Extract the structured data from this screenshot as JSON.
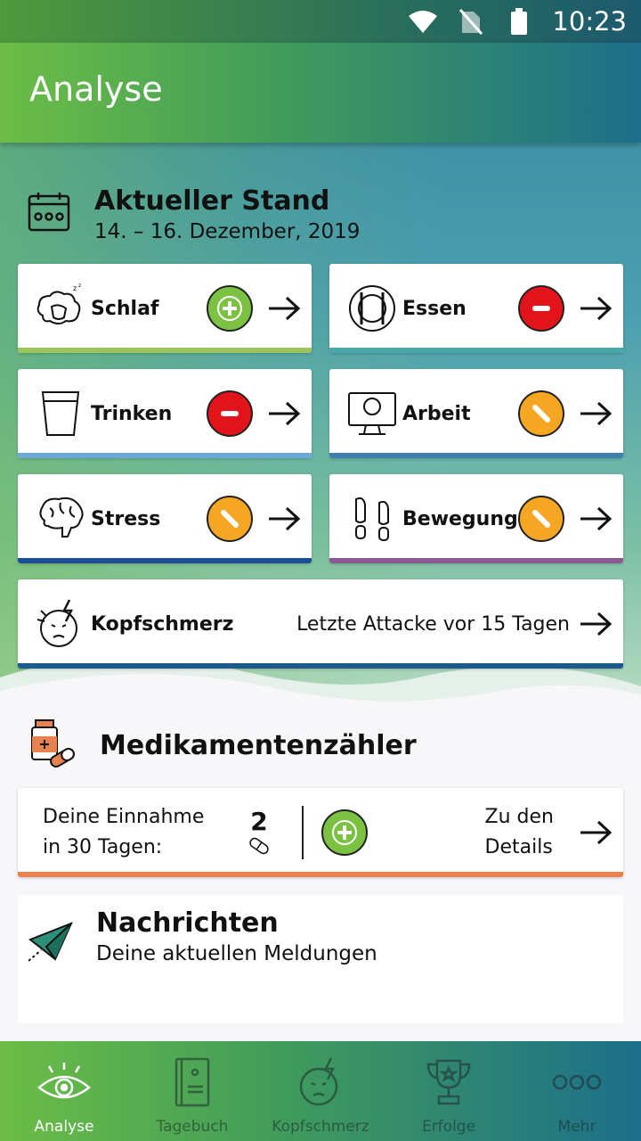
{
  "status_bar": {
    "time": "10:23",
    "icons": [
      "wifi-icon",
      "no-sim-icon",
      "battery-icon"
    ]
  },
  "header": {
    "title": "Analyse"
  },
  "current": {
    "title": "Aktueller Stand",
    "date_range": "14. – 16. Dezember, 2019",
    "icon": "calendar-icon",
    "cards": [
      {
        "label": "Schlaf",
        "icon": "sleep-icon",
        "status": "positive",
        "bar_color": "#9cc45c"
      },
      {
        "label": "Essen",
        "icon": "food-icon",
        "status": "negative",
        "bar_color": "#4aa7a9"
      },
      {
        "label": "Trinken",
        "icon": "glass-icon",
        "status": "negative",
        "bar_color": "#6aa9d8"
      },
      {
        "label": "Arbeit",
        "icon": "computer-icon",
        "status": "neutral",
        "bar_color": "#3f7fae"
      },
      {
        "label": "Stress",
        "icon": "brain-icon",
        "status": "neutral",
        "bar_color": "#1c4f93"
      },
      {
        "label": "Bewegung",
        "icon": "footsteps-icon",
        "status": "neutral",
        "bar_color": "#8a5a95"
      }
    ],
    "headache": {
      "label": "Kopfschmerz",
      "info": "Letzte Attacke vor 15 Tagen",
      "icon": "headache-face-icon",
      "bar_color": "#1c5a8c"
    }
  },
  "medication": {
    "title": "Medikamentenzähler",
    "intake_label": "Deine Einnahme in 30 Tagen:",
    "intake_line1": "Deine Einnahme",
    "intake_line2": "in 30 Tagen:",
    "count": "2",
    "details_line1": "Zu den",
    "details_line2": "Details",
    "bar_color": "#e8834f"
  },
  "news": {
    "title": "Nachrichten",
    "subtitle": "Deine aktuellen Meldungen",
    "icon": "paper-plane-icon"
  },
  "bottom_nav": [
    {
      "label": "Analyse",
      "icon": "eye-icon",
      "active": true
    },
    {
      "label": "Tagebuch",
      "icon": "book-icon",
      "active": false
    },
    {
      "label": "Kopfschmerz",
      "icon": "headache-face-icon",
      "active": false
    },
    {
      "label": "Erfolge",
      "icon": "trophy-icon",
      "active": false
    },
    {
      "label": "Mehr",
      "icon": "more-icon",
      "active": false
    }
  ],
  "colors": {
    "positive": "#7cc242",
    "negative": "#e3131b",
    "neutral": "#f5a623"
  }
}
